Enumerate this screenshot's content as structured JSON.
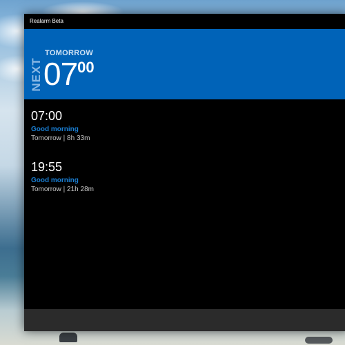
{
  "window": {
    "title": "Realarm Beta"
  },
  "next": {
    "vertical_label": "NEXT",
    "day": "TOMORROW",
    "hour": "07",
    "minute": "00"
  },
  "alarms": [
    {
      "time": "07:00",
      "label": "Good morning",
      "when": "Tomorrow | 8h 33m"
    },
    {
      "time": "19:55",
      "label": "Good morning",
      "when": "Tomorrow | 21h 28m"
    }
  ],
  "colors": {
    "accent": "#0063b8",
    "label_blue": "#1a7fd4",
    "window_bg": "#000000",
    "bottombar": "#2b2b2b"
  }
}
